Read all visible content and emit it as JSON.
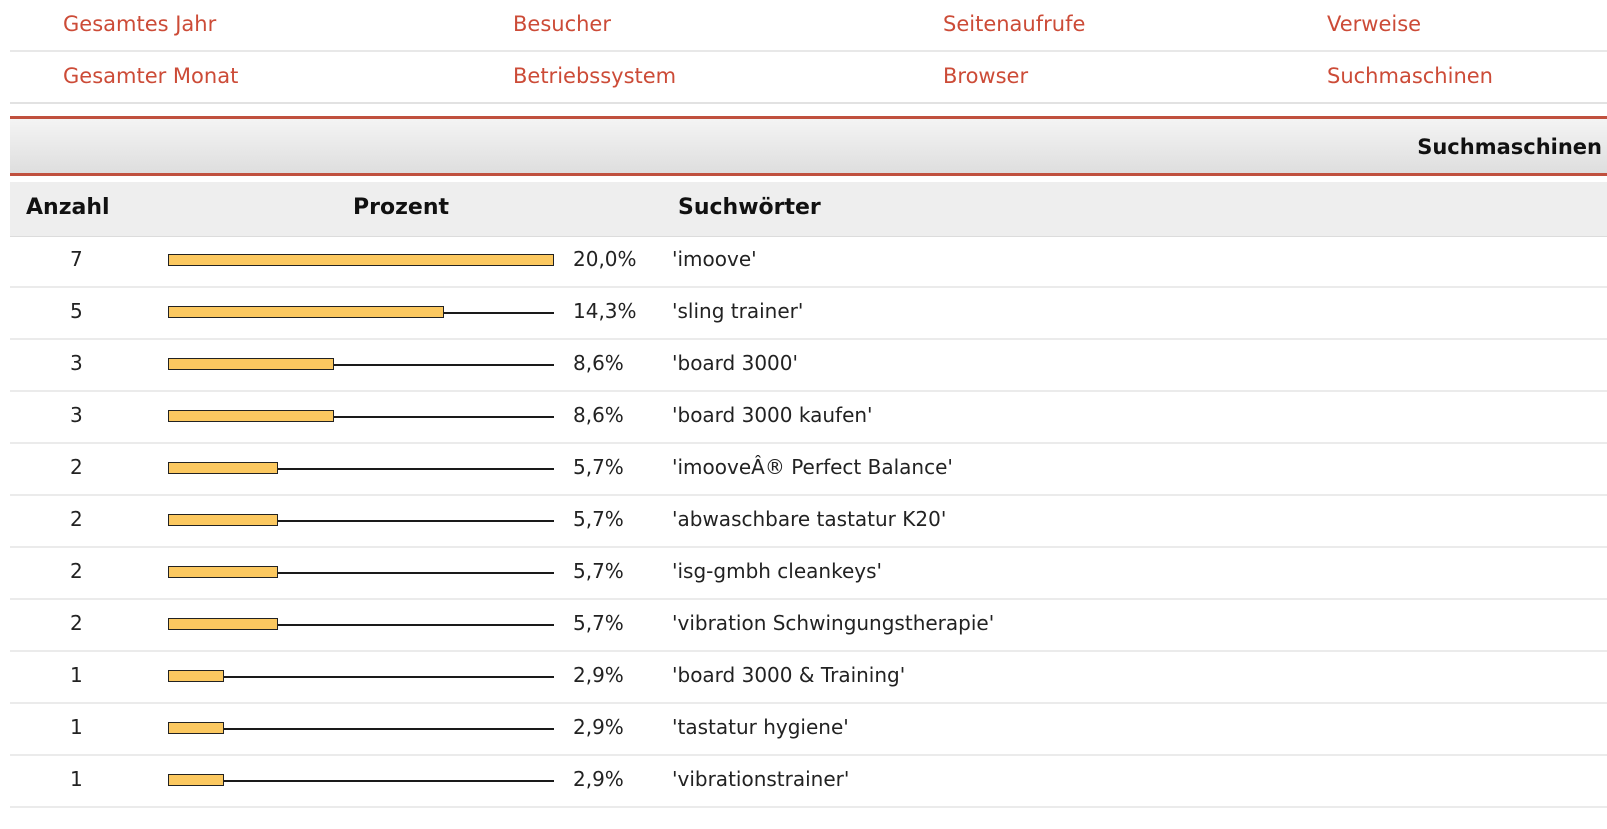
{
  "nav": {
    "row1": [
      "Gesamtes Jahr",
      "Besucher",
      "Seitenaufrufe",
      "Verweise"
    ],
    "row2": [
      "Gesamter Monat",
      "Betriebssystem",
      "Browser",
      "Suchmaschinen"
    ],
    "link_color": "#cc4b37"
  },
  "section": {
    "title": "Suchmaschinen",
    "accent_color": "#c0503e"
  },
  "table": {
    "headers": {
      "count": "Anzahl",
      "percent": "Prozent",
      "keywords": "Suchwörter"
    },
    "bar_color": "#fbc860",
    "rows": [
      {
        "count": "7",
        "percent": "20,0%",
        "fraction": 1.0,
        "keyword": "'imoove'"
      },
      {
        "count": "5",
        "percent": "14,3%",
        "fraction": 0.715,
        "keyword": "'sling trainer'"
      },
      {
        "count": "3",
        "percent": "8,6%",
        "fraction": 0.43,
        "keyword": "'board 3000'"
      },
      {
        "count": "3",
        "percent": "8,6%",
        "fraction": 0.43,
        "keyword": "'board 3000 kaufen'"
      },
      {
        "count": "2",
        "percent": "5,7%",
        "fraction": 0.285,
        "keyword": "'imooveÂ® Perfect Balance'"
      },
      {
        "count": "2",
        "percent": "5,7%",
        "fraction": 0.285,
        "keyword": "'abwaschbare tastatur K20'"
      },
      {
        "count": "2",
        "percent": "5,7%",
        "fraction": 0.285,
        "keyword": "'isg-gmbh cleankeys'"
      },
      {
        "count": "2",
        "percent": "5,7%",
        "fraction": 0.285,
        "keyword": "'vibration Schwingungstherapie'"
      },
      {
        "count": "1",
        "percent": "2,9%",
        "fraction": 0.145,
        "keyword": "'board 3000 & Training'"
      },
      {
        "count": "1",
        "percent": "2,9%",
        "fraction": 0.145,
        "keyword": "'tastatur hygiene'"
      },
      {
        "count": "1",
        "percent": "2,9%",
        "fraction": 0.145,
        "keyword": "'vibrationstrainer'"
      }
    ]
  }
}
